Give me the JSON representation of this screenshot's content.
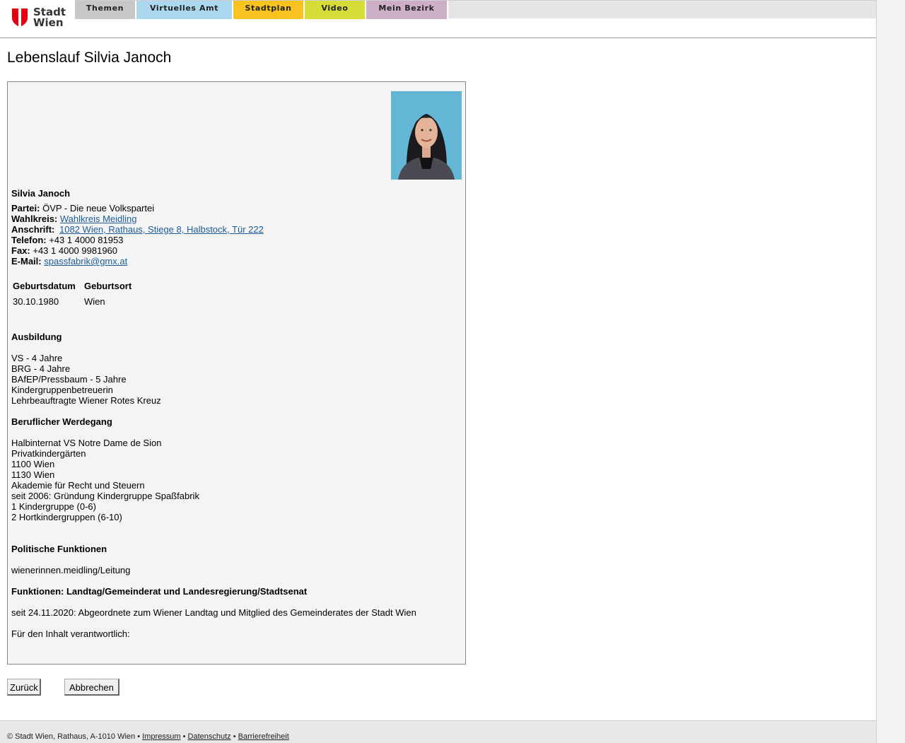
{
  "brand": {
    "logo_line1": "Stadt",
    "logo_line2": "Wien",
    "logo_red": "#e3000f"
  },
  "nav": {
    "tabs": [
      {
        "label": "Themen",
        "color": "#c8c8c8"
      },
      {
        "label": "Virtuelles Amt",
        "color": "#acd8ef"
      },
      {
        "label": "Stadtplan",
        "color": "#f8c31f"
      },
      {
        "label": "Video",
        "color": "#d6dc38"
      },
      {
        "label": "Mein Bezirk",
        "color": "#cdb0c8"
      }
    ]
  },
  "page": {
    "title": "Lebenslauf Silvia Janoch"
  },
  "profile": {
    "name": "Silvia Janoch",
    "partei_label": "Partei:",
    "partei": "ÖVP - Die neue Volkspartei",
    "wahlkreis_label": "Wahlkreis:",
    "wahlkreis": "Wahlkreis Meidling",
    "anschrift_label": "Anschrift:",
    "anschrift": "1082 Wien, Rathaus, Stiege 8, Halbstock, Tür 222",
    "telefon_label": "Telefon:",
    "telefon": "+43 1 4000 81953",
    "fax_label": "Fax:",
    "fax": "+43 1 4000 9981960",
    "email_label": "E-Mail:",
    "email": "spassfabrik@gmx.at"
  },
  "birth": {
    "headers": [
      "Geburtsdatum",
      "Geburtsort"
    ],
    "values": [
      "30.10.1980",
      "Wien"
    ]
  },
  "ausbildung": {
    "heading": "Ausbildung",
    "lines": [
      "VS - 4 Jahre",
      "BRG - 4 Jahre",
      "BAfEP/Pressbaum - 5 Jahre",
      "Kindergruppenbetreuerin",
      "Lehrbeauftragte Wiener Rotes Kreuz"
    ]
  },
  "beruf": {
    "heading": "Beruflicher Werdegang",
    "lines": [
      "Halbinternat VS Notre Dame de Sion",
      "Privatkindergärten",
      "1100 Wien",
      "1130 Wien",
      "Akademie für Recht und Steuern",
      "seit 2006: Gründung Kindergruppe Spaßfabrik",
      "1 Kindergruppe (0-6)",
      "2 Hortkindergruppen (6-10)"
    ]
  },
  "politik": {
    "heading": "Politische Funktionen",
    "line": "wienerinnen.meidling/Leitung"
  },
  "funktionen": {
    "heading": "Funktionen: Landtag/Gemeinderat und Landesregierung/Stadtsenat",
    "line": "seit 24.11.2020: Abgeordnete zum Wiener Landtag und Mitglied des Gemeinderates der Stadt Wien"
  },
  "verantwortlich": "Für den Inhalt verantwortlich:",
  "buttons": {
    "back": "Zurück",
    "cancel": "Abbrechen"
  },
  "footer": {
    "copyright": "© Stadt Wien, Rathaus, A-1010 Wien •",
    "links": [
      "Impressum",
      "Datenschutz",
      "Barrierefreiheit"
    ],
    "separator": "•"
  }
}
